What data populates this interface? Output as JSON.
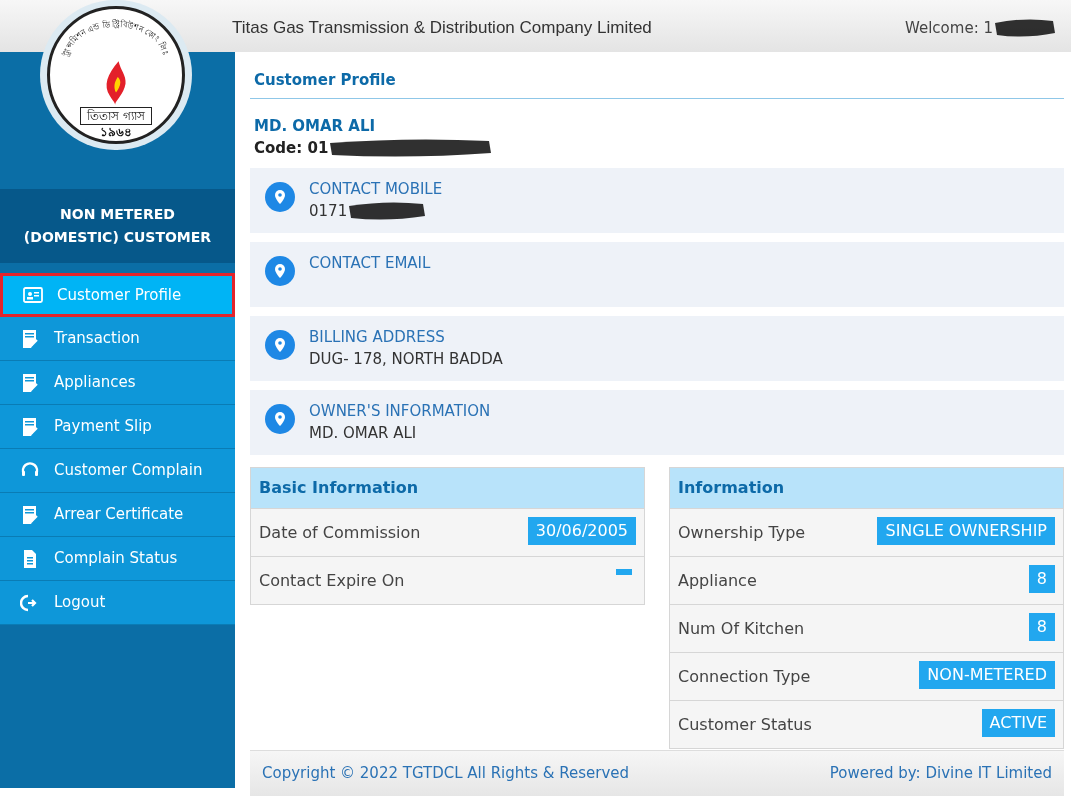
{
  "header": {
    "company": "Titas Gas Transmission & Distribution Company Limited",
    "welcome": "Welcome: 1"
  },
  "logo": {
    "arc_text": "ট্রান্সমিশন এন্ড ডিস্ট্রিবিউশন কোং লিঃ",
    "name": "তিতাস গ্যাস",
    "year": "১৯৬৪"
  },
  "sidebar": {
    "title_line_1": "NON METERED",
    "title_line_2": "(DOMESTIC) CUSTOMER",
    "items": [
      {
        "label": "Customer Profile",
        "kind": "profile",
        "selected": true
      },
      {
        "label": "Transaction",
        "kind": "form",
        "selected": false
      },
      {
        "label": "Appliances",
        "kind": "form",
        "selected": false
      },
      {
        "label": "Payment Slip",
        "kind": "form",
        "selected": false
      },
      {
        "label": "Customer Complain",
        "kind": "headset",
        "selected": false
      },
      {
        "label": "Arrear Certificate",
        "kind": "form",
        "selected": false
      },
      {
        "label": "Complain Status",
        "kind": "document",
        "selected": false
      },
      {
        "label": "Logout",
        "kind": "logout",
        "selected": false
      }
    ]
  },
  "profile": {
    "heading": "Customer Profile",
    "name": "MD. OMAR ALI",
    "code_label": "Code:",
    "code": "01",
    "cards": [
      {
        "title": "CONTACT MOBILE",
        "value": "0171"
      },
      {
        "title": "CONTACT EMAIL"
      },
      {
        "title": "BILLING ADDRESS",
        "value": "DUG- 178, NORTH BADDA"
      },
      {
        "title": "OWNER'S INFORMATION",
        "value": "MD. OMAR ALI"
      }
    ]
  },
  "basic_information": {
    "title": "Basic Information",
    "rows": [
      {
        "label": "Date of Commission",
        "value": "30/06/2005"
      },
      {
        "label": "Contact Expire On",
        "value": ""
      }
    ]
  },
  "information": {
    "title": "Information",
    "rows": [
      {
        "label": "Ownership Type",
        "value": "SINGLE OWNERSHIP"
      },
      {
        "label": "Appliance",
        "value": "8"
      },
      {
        "label": "Num Of Kitchen",
        "value": "8"
      },
      {
        "label": "Connection Type",
        "value": "NON-METERED"
      },
      {
        "label": "Customer Status",
        "value": "ACTIVE"
      }
    ]
  },
  "footer": {
    "copyright": "Copyright © 2022 TGTDCL All Rights & Reserved",
    "powered_by": "Powered by: Divine IT Limited"
  }
}
